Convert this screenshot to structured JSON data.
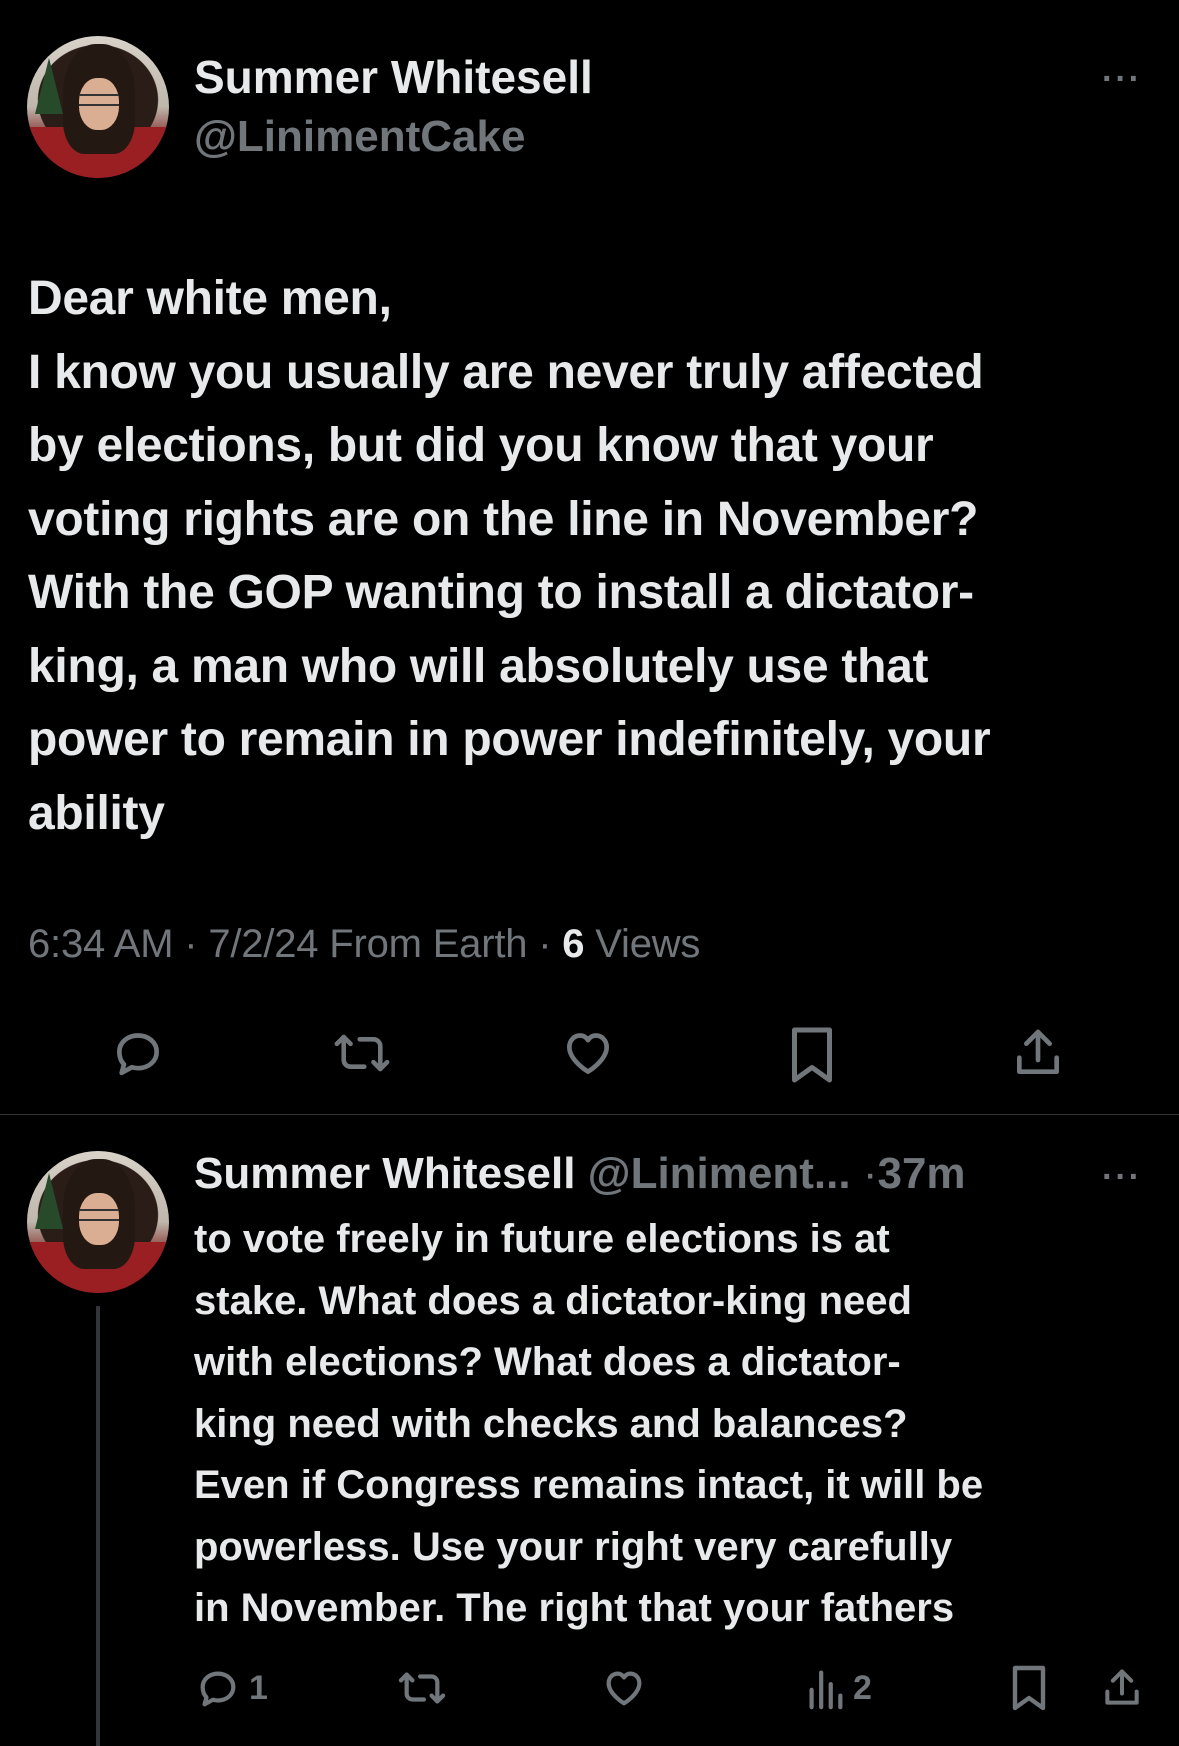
{
  "main_tweet": {
    "author_name": "Summer Whitesell",
    "author_handle": "@LinimentCake",
    "more_label": "···",
    "text_lines": [
      "Dear white men,",
      "I know you usually are never truly affected",
      "by elections, but did you know that your",
      "voting rights are on the line in November?",
      "With the GOP wanting to install a dictator-",
      "king, a man who will absolutely use that",
      "power to remain in power indefinitely, your",
      "ability"
    ],
    "time": "6:34 AM",
    "date": "7/2/24",
    "source": "From Earth",
    "views_count": "6",
    "views_label": "Views",
    "separator": "·"
  },
  "actions": {
    "reply_icon": "reply-icon",
    "retweet_icon": "retweet-icon",
    "like_icon": "heart-icon",
    "bookmark_icon": "bookmark-icon",
    "share_icon": "share-icon"
  },
  "reply_tweet": {
    "author_name": "Summer Whitesell",
    "author_handle": "@Liniment...",
    "separator": "·",
    "time_ago": "37m",
    "more_label": "···",
    "text_lines": [
      "to vote freely in future elections is at",
      "stake. What does a dictator-king need",
      "with elections? What does a dictator-",
      "king need with checks and balances?",
      "Even if Congress remains intact, it will be",
      "powerless. Use your right very carefully",
      "in November. The right that your fathers"
    ],
    "reply_count": "1",
    "retweet_count": "",
    "like_count": "",
    "views_count": "2"
  },
  "colors": {
    "background": "#000000",
    "text": "#e7e9ea",
    "muted": "#71767b",
    "divider": "#2f3336"
  }
}
